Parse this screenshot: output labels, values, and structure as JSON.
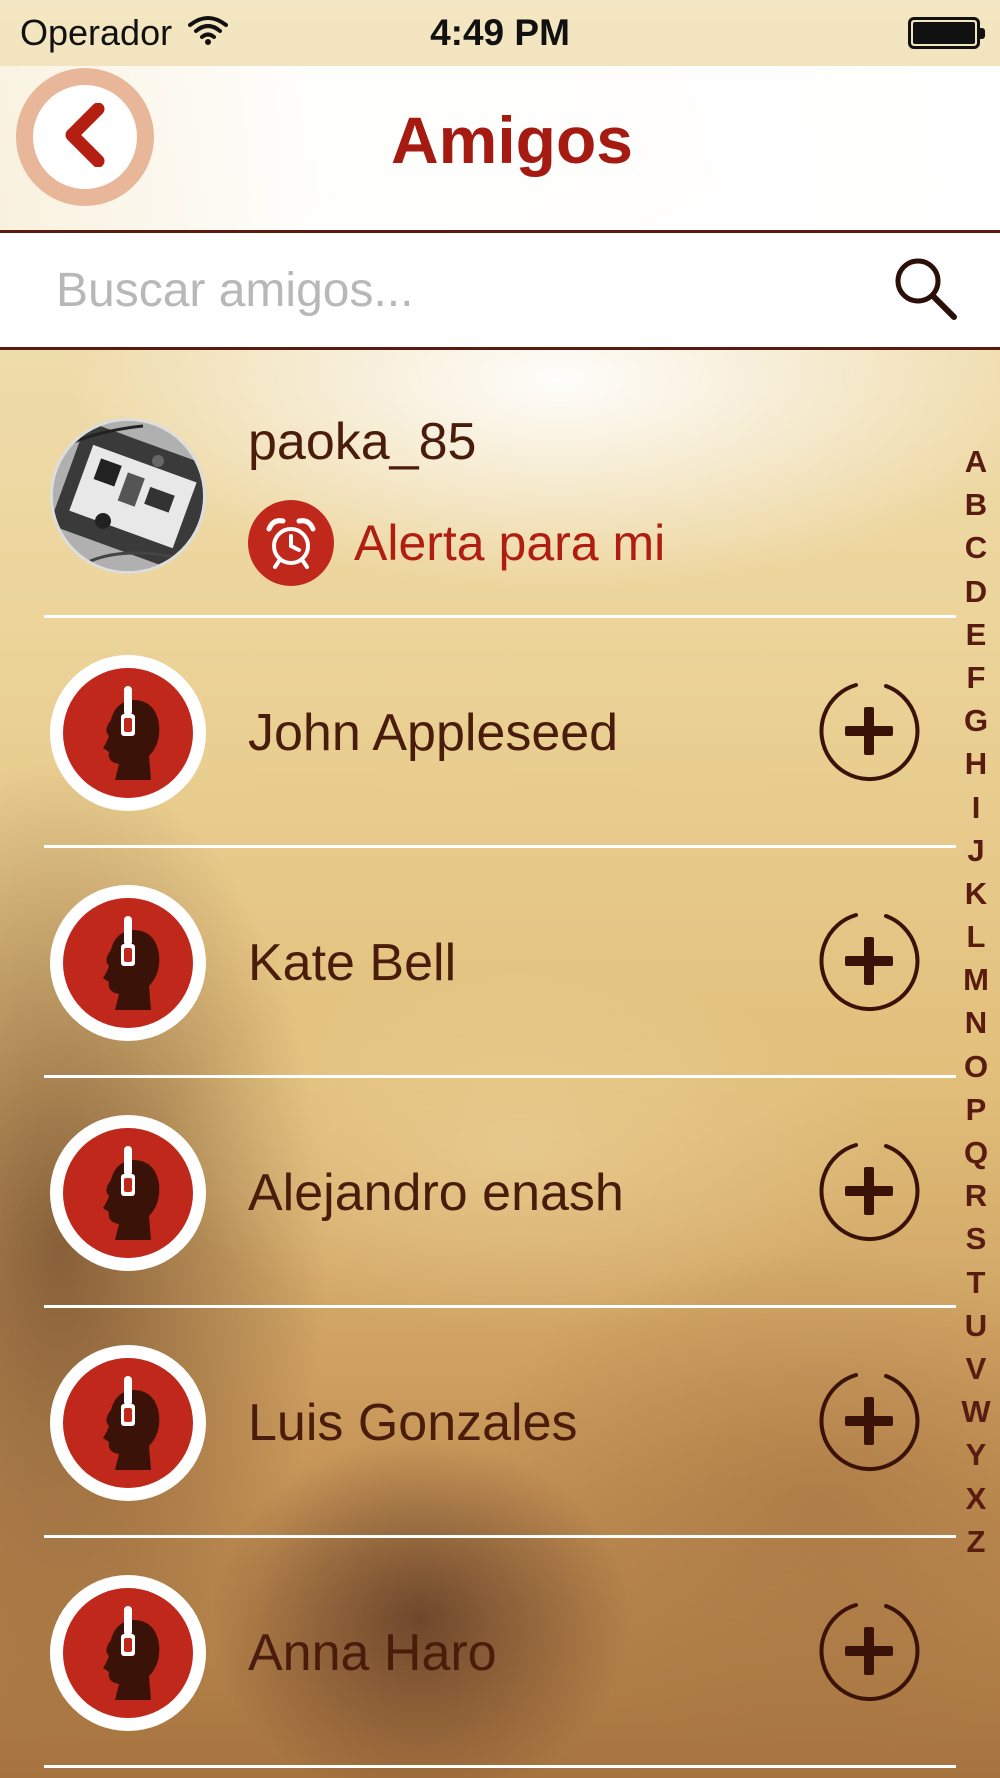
{
  "status_bar": {
    "carrier": "Operador",
    "time": "4:49 PM",
    "battery_level": 1.0
  },
  "header": {
    "title": "Amigos"
  },
  "search": {
    "placeholder": "Buscar amigos..."
  },
  "me": {
    "username": "paoka_85",
    "alert_label": "Alerta para mi"
  },
  "friends": [
    {
      "name": "John Appleseed"
    },
    {
      "name": "Kate Bell"
    },
    {
      "name": "Alejandro enash"
    },
    {
      "name": "Luis Gonzales"
    },
    {
      "name": "Anna Haro"
    }
  ],
  "alphabet_index": [
    "A",
    "B",
    "C",
    "D",
    "E",
    "F",
    "G",
    "H",
    "I",
    "J",
    "K",
    "L",
    "M",
    "N",
    "O",
    "P",
    "Q",
    "R",
    "S",
    "T",
    "U",
    "V",
    "W",
    "Y",
    "X",
    "Z"
  ],
  "colors": {
    "accent": "#c0281b",
    "title": "#a51b12",
    "text": "#4a1c0c",
    "divider": "#5a1b10"
  },
  "icons": {
    "back": "chevron-left-icon",
    "search": "search-icon",
    "alert": "alarm-clock-icon",
    "default_avatar": "headphones-head-icon",
    "add": "plus-circle-icon",
    "wifi": "wifi-icon",
    "battery": "battery-icon"
  }
}
